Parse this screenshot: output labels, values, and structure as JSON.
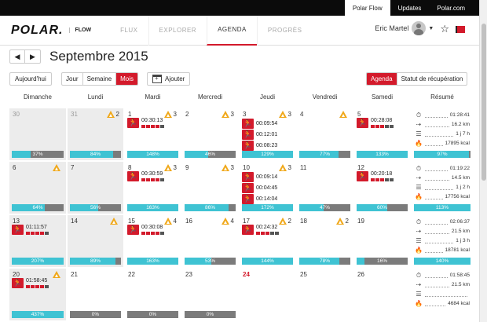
{
  "topbar": {
    "links": [
      "Polar Flow",
      "Updates",
      "Polar.com"
    ],
    "active": 0
  },
  "header": {
    "logo": "POLAR.",
    "product": "FLOW",
    "nav": [
      "FLUX",
      "EXPLORER",
      "AGENDA",
      "PROGRÈS"
    ],
    "active_nav": 2,
    "user_name": "Eric Martel"
  },
  "calendar": {
    "title": "Septembre 2015",
    "today_button": "Aujourd'hui",
    "views": [
      "Jour",
      "Semaine",
      "Mois"
    ],
    "active_view": 2,
    "add_button": "Ajouter",
    "modes": [
      "Agenda",
      "Statut de récupération"
    ],
    "active_mode": 0,
    "day_headers": [
      "Dimanche",
      "Lundi",
      "Mardi",
      "Mercredi",
      "Jeudi",
      "Vendredi",
      "Samedi",
      "Résumé"
    ],
    "weeks": [
      {
        "days": [
          {
            "num": "30",
            "outside": true,
            "progress": 37
          },
          {
            "num": "31",
            "outside": true,
            "targets": "2",
            "progress": 84
          },
          {
            "num": "1",
            "targets": "3",
            "progress": 148,
            "sessions": [
              {
                "duration": "00:30:13",
                "zones": 4
              }
            ]
          },
          {
            "num": "2",
            "targets": "3",
            "progress": 46
          },
          {
            "num": "3",
            "targets": "3",
            "progress": 129,
            "sessions": [
              {
                "duration": "00:09:54"
              },
              {
                "duration": "00:12:01"
              },
              {
                "duration": "00:08:23"
              }
            ]
          },
          {
            "num": "4",
            "targets": "",
            "progress": 77
          },
          {
            "num": "5",
            "progress": 133,
            "sessions": [
              {
                "duration": "00:28:08",
                "zones": 3
              }
            ]
          }
        ],
        "summary": {
          "duration": "01:28:41",
          "distance": "16.2 km",
          "sessions": "1 j 7 h",
          "calories": "17895 kcal",
          "progress": 97
        }
      },
      {
        "days": [
          {
            "num": "6",
            "targets": "",
            "progress": 64
          },
          {
            "num": "7",
            "progress": 56
          },
          {
            "num": "8",
            "targets": "3",
            "progress": 163,
            "sessions": [
              {
                "duration": "00:30:59",
                "zones": 4
              }
            ]
          },
          {
            "num": "9",
            "targets": "3",
            "progress": 86
          },
          {
            "num": "10",
            "targets": "3",
            "progress": 172,
            "sessions": [
              {
                "duration": "00:09:14"
              },
              {
                "duration": "00:04:45"
              },
              {
                "duration": "00:14:04"
              }
            ]
          },
          {
            "num": "11",
            "progress": 47
          },
          {
            "num": "12",
            "progress": 60,
            "sessions": [
              {
                "duration": "00:20:18",
                "zones": 3
              }
            ]
          }
        ],
        "summary": {
          "duration": "01:19:22",
          "distance": "14.5 km",
          "sessions": "1 j 2 h",
          "calories": "17756 kcal",
          "progress": 113
        }
      },
      {
        "days": [
          {
            "num": "13",
            "progress": 207,
            "sessions": [
              {
                "duration": "01:11:57",
                "zones": 4
              }
            ]
          },
          {
            "num": "14",
            "targets": "",
            "progress": 89
          },
          {
            "num": "15",
            "targets": "4",
            "progress": 163,
            "sessions": [
              {
                "duration": "00:30:08",
                "zones": 4
              }
            ]
          },
          {
            "num": "16",
            "targets": "4",
            "progress": 53
          },
          {
            "num": "17",
            "targets": "2",
            "progress": 144,
            "sessions": [
              {
                "duration": "00:24:32",
                "zones": 3
              }
            ]
          },
          {
            "num": "18",
            "targets": "2",
            "progress": 78
          },
          {
            "num": "19",
            "progress": 16
          }
        ],
        "summary": {
          "duration": "02:06:37",
          "distance": "21.5 km",
          "sessions": "1 j 3 h",
          "calories": "18781 kcal",
          "progress": 140
        }
      },
      {
        "days": [
          {
            "num": "20",
            "targets": "",
            "progress": 437,
            "sessions": [
              {
                "duration": "01:58:45",
                "zones": 4
              }
            ]
          },
          {
            "num": "21",
            "progress": 0
          },
          {
            "num": "22",
            "progress": 0
          },
          {
            "num": "23",
            "progress": 0
          },
          {
            "num": "24",
            "today": true
          },
          {
            "num": "25"
          },
          {
            "num": "26"
          }
        ],
        "summary": {
          "duration": "01:58:45",
          "distance": "21.5 km",
          "sessions": "",
          "calories": "4684 kcal"
        }
      }
    ]
  },
  "icons": {
    "run": "running-figure-icon",
    "target": "triangle-target-icon",
    "clock": "stopwatch-icon",
    "distance": "route-icon",
    "sessions": "calendar-icon",
    "calories": "flame-icon"
  },
  "colors": {
    "accent": "#d31a2b",
    "progress": "#3fc3d3",
    "target": "#f0a81a"
  }
}
